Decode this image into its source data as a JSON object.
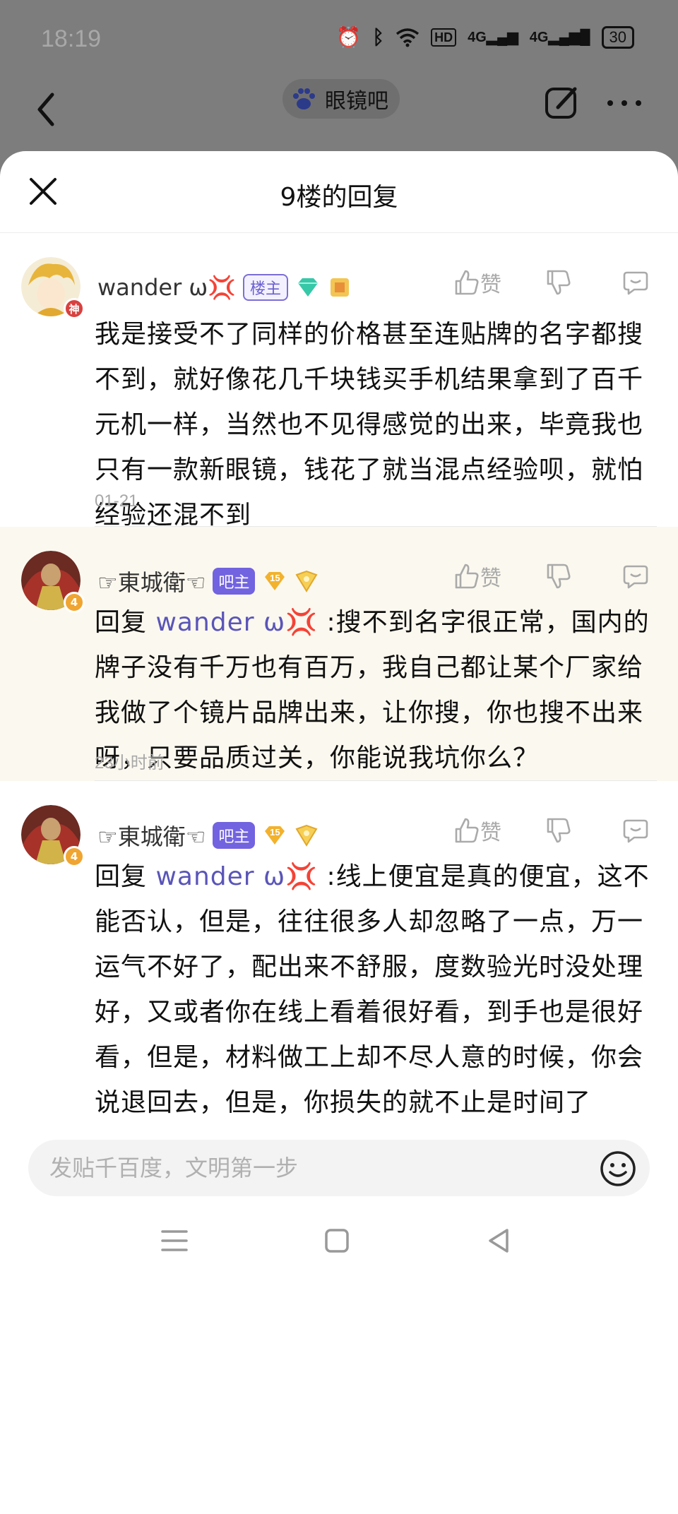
{
  "status_bar": {
    "time": "18:19",
    "network_label": "HD",
    "signal_1": "4G",
    "signal_2": "4G",
    "battery": "30"
  },
  "topbar": {
    "forum_name": "眼镜吧"
  },
  "sheet": {
    "title": "9楼的回复"
  },
  "like_label": "赞",
  "replies": [
    {
      "user": "wander ω💢",
      "avatar_badge": "神",
      "role_tag": "楼主",
      "content": "我是接受不了同样的价格甚至连贴牌的名字都搜不到，就好像花几千块钱买手机结果拿到了百千元机一样，当然也不见得感觉的出来，毕竟我也只有一款新眼镜，钱花了就当混点经验呗，就怕经验还混不到",
      "time": "01-21"
    },
    {
      "user": "☞東城衛☜",
      "avatar_badge": "4",
      "role_tag": "吧主",
      "level": "15",
      "reply_prefix": "回复 ",
      "mention": "wander ω💢",
      "content": " :搜不到名字很正常，国内的牌子没有千万也有百万，我自己都让某个厂家给我做了个镜片品牌出来，让你搜，你也搜不出来呀，只要品质过关，你能说我坑你么？",
      "time": "23小时前"
    },
    {
      "user": "☞東城衛☜",
      "avatar_badge": "4",
      "role_tag": "吧主",
      "level": "15",
      "reply_prefix": "回复 ",
      "mention": "wander ω💢",
      "content": " :线上便宜是真的便宜，这不能否认，但是，往往很多人却忽略了一点，万一运气不好了，配出来不舒服，度数验光时没处理好，又或者你在线上看着很好看，到手也是很好看，但是，材料做工上却不尽人意的时候，你会说退回去，但是，你损失的就不止是时间了"
    }
  ],
  "input": {
    "placeholder": "发贴千百度，文明第一步"
  },
  "colors": {
    "accent": "#7263e0",
    "mention": "#5a55b8",
    "shaded_bg": "#fbf8ef"
  }
}
